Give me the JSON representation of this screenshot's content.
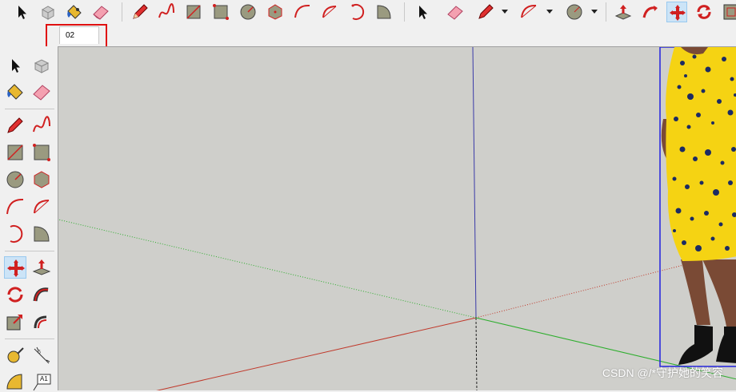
{
  "tabs": [
    {
      "label": "02"
    }
  ],
  "watermark": "CSDN @/*守护她的笑容",
  "colors": {
    "axis_red": "#c0392b",
    "axis_green": "#2eae2e",
    "axis_blue": "#3a3aa8",
    "viewport_bg": "#cfcfcb",
    "highlight": "#e01010",
    "dress_yellow": "#f5d313",
    "dress_dots": "#1c2b63"
  },
  "toolbar_top": {
    "groups": [
      [
        "select-tool",
        "make-component-tool",
        "paint-bucket-tool",
        "eraser-tool"
      ],
      [
        "pencil-tool",
        "freehand-tool",
        "rectangle-tool",
        "rotated-rectangle-tool",
        "circle-tool",
        "polygon-tool",
        "arc-tool",
        "pie-tool",
        "3-point-arc-tool",
        "2-point-arc-tool"
      ],
      [
        "select-tool",
        "eraser-tool",
        "pencil-tool-dropdown",
        "arc-tool-dropdown",
        "circle-tool-dropdown"
      ],
      [
        "push-pull-tool",
        "follow-me-tool",
        "move-tool",
        "rotate-tool",
        "offset-tool"
      ]
    ]
  },
  "toolbar_left": {
    "tools": [
      "select-tool",
      "make-component-tool",
      "paint-bucket-tool",
      "eraser-tool",
      "pencil-tool",
      "freehand-tool",
      "rectangle-tool",
      "rotated-rectangle-tool",
      "circle-tool",
      "polygon-tool",
      "arc-tool",
      "2-point-arc-tool",
      "3-point-arc-tool",
      "pie-tool",
      "move-tool",
      "push-pull-tool",
      "rotate-tool",
      "follow-me-tool",
      "scale-tool",
      "offset-tool",
      "tape-measure-tool",
      "dimension-tool",
      "protractor-tool",
      "text-tool"
    ],
    "text_tool_label": "A1"
  }
}
